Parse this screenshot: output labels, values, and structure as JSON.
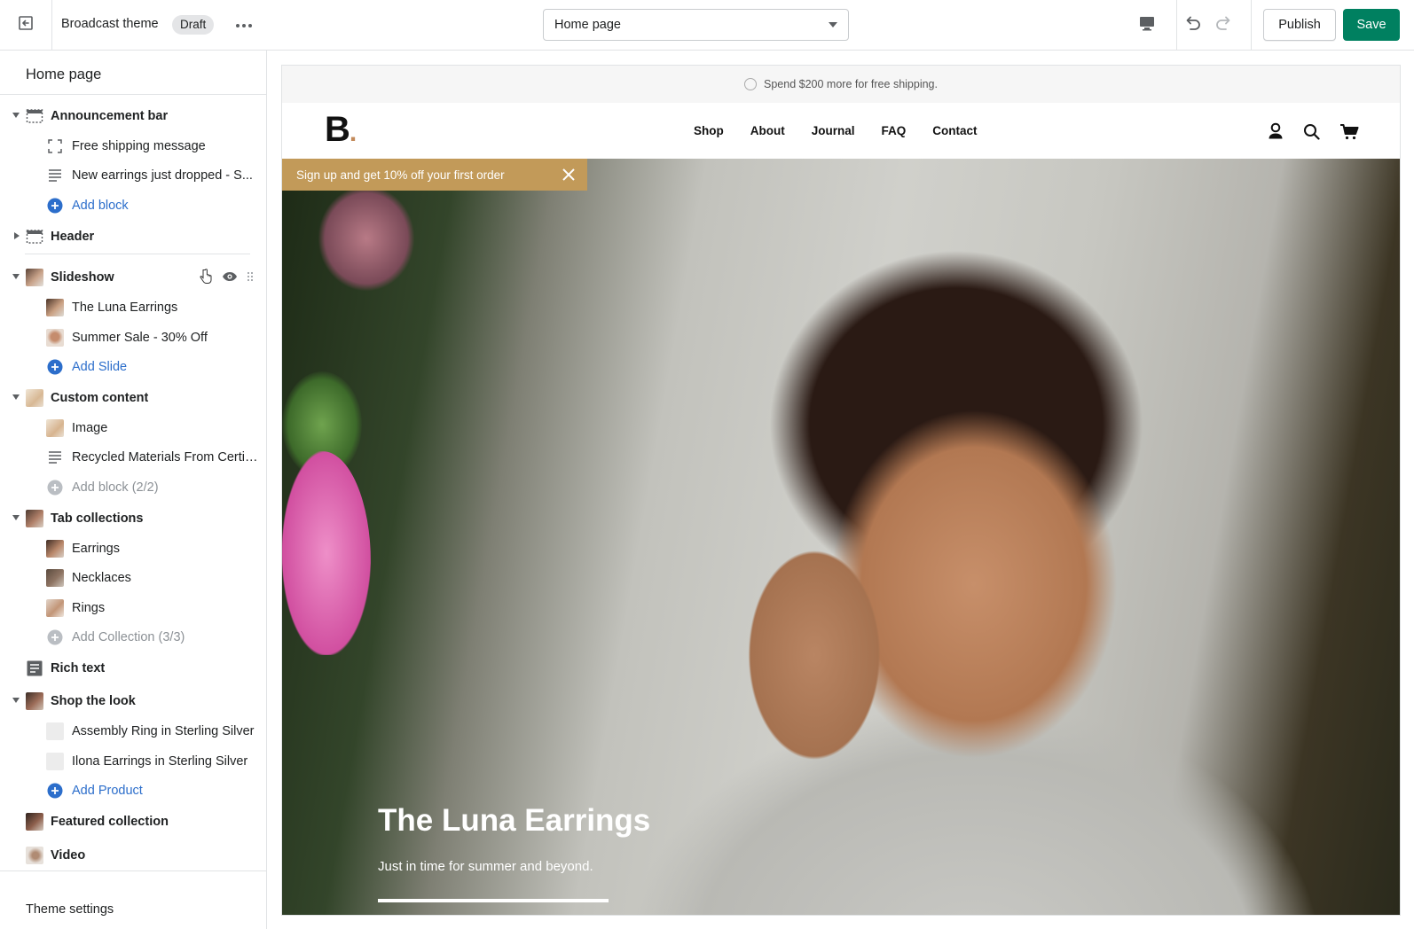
{
  "topbar": {
    "theme_name": "Broadcast theme",
    "status_badge": "Draft",
    "page_select_value": "Home page",
    "publish_label": "Publish",
    "save_label": "Save",
    "accent": "#008060"
  },
  "sidebar": {
    "title": "Home page",
    "items": [
      {
        "label": "Announcement bar"
      },
      {
        "label": "Free shipping message"
      },
      {
        "label": "New earrings just dropped - S..."
      },
      {
        "label": "Add block"
      },
      {
        "label": "Header"
      },
      {
        "label": "Slideshow"
      },
      {
        "label": "The Luna Earrings"
      },
      {
        "label": "Summer Sale - 30% Off"
      },
      {
        "label": "Add Slide"
      },
      {
        "label": "Custom content"
      },
      {
        "label": "Image"
      },
      {
        "label": "Recycled Materials From Certif..."
      },
      {
        "label": "Add block (2/2)"
      },
      {
        "label": "Tab collections"
      },
      {
        "label": "Earrings"
      },
      {
        "label": "Necklaces"
      },
      {
        "label": "Rings"
      },
      {
        "label": "Add Collection (3/3)"
      },
      {
        "label": "Rich text"
      },
      {
        "label": "Shop the look"
      },
      {
        "label": "Assembly Ring in Sterling Silver"
      },
      {
        "label": "Ilona Earrings in Sterling Silver"
      },
      {
        "label": "Add Product"
      },
      {
        "label": "Featured collection"
      },
      {
        "label": "Video"
      }
    ],
    "theme_settings": "Theme settings"
  },
  "preview": {
    "announcement": "Spend $200 more for free shipping.",
    "logo": "B",
    "logo_dot": ".",
    "nav": [
      "Shop",
      "About",
      "Journal",
      "FAQ",
      "Contact"
    ],
    "promo": "Sign up and get 10% off your first order",
    "hero_title": "The Luna Earrings",
    "hero_subtitle": "Just in time for summer and beyond."
  }
}
